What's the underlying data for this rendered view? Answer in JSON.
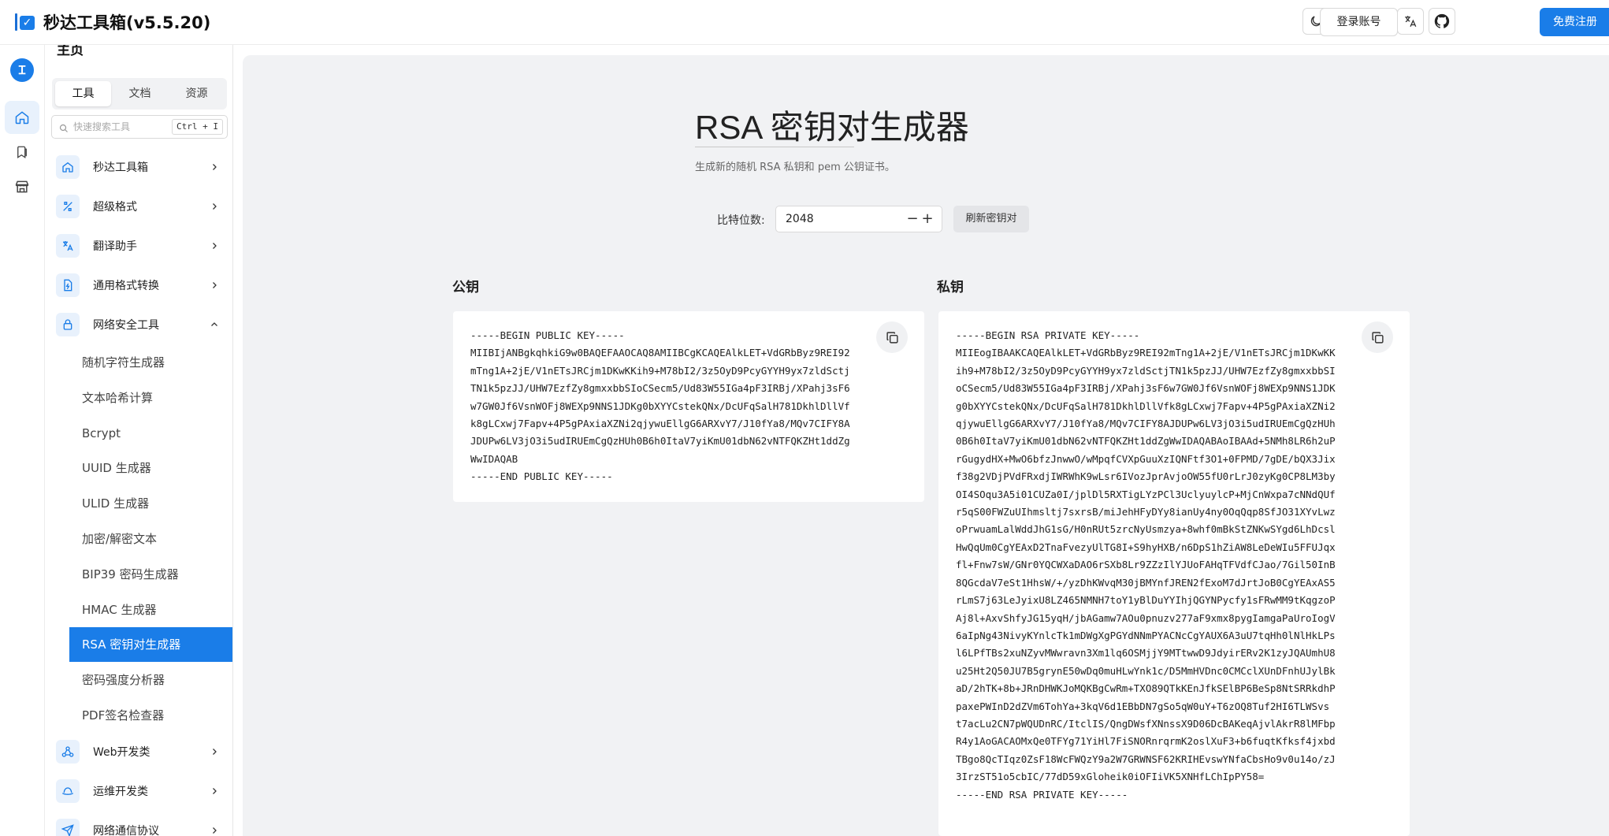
{
  "app": {
    "title": "秒达工具箱(v5.5.20)",
    "logo_check": "✓"
  },
  "header": {
    "icons": [
      "moon-icon",
      "font-icon",
      "search-text-icon",
      "translate-icon",
      "github-icon"
    ],
    "login_label": "登录账号",
    "register_label": "免费注册"
  },
  "rail": {
    "avatar_letter": "Ɪ",
    "items": [
      "home-icon",
      "bookmark-icon",
      "store-icon"
    ]
  },
  "sidebar": {
    "heading": "主页",
    "tabs": [
      "工具",
      "文档",
      "资源"
    ],
    "search_placeholder": "快速搜索工具",
    "search_shortcut": "Ctrl + I",
    "groups": [
      {
        "label": "秒达工具箱"
      },
      {
        "label": "超级格式"
      },
      {
        "label": "翻译助手"
      },
      {
        "label": "通用格式转换"
      },
      {
        "label": "网络安全工具"
      }
    ],
    "security_items": [
      "随机字符生成器",
      "文本哈希计算",
      "Bcrypt",
      "UUID 生成器",
      "ULID 生成器",
      "加密/解密文本",
      "BIP39 密码生成器",
      "HMAC 生成器",
      "RSA 密钥对生成器",
      "密码强度分析器",
      "PDF签名检查器"
    ],
    "more_groups": [
      {
        "label": "Web开发类"
      },
      {
        "label": "运维开发类"
      },
      {
        "label": "网络通信协议"
      }
    ]
  },
  "main": {
    "title": "RSA 密钥对生成器",
    "description": "生成新的随机 RSA 私钥和 pem 公钥证书。",
    "bits_label": "比特位数:",
    "bits_value": "2048",
    "minus": "−",
    "plus": "+",
    "refresh_label": "刷新密钥对",
    "public_label": "公钥",
    "private_label": "私钥",
    "public_key": "-----BEGIN PUBLIC KEY-----\nMIIBIjANBgkqhkiG9w0BAQEFAAOCAQ8AMIIBCgKCAQEAlkLET+VdGRbByz9REI92\nmTng1A+2jE/V1nETsJRCjm1DKwKKih9+M78bI2/3z5OyD9PcyGYYH9yx7zldSctj\nTN1k5pzJJ/UHW7EzfZy8gmxxbbSIoCSecm5/Ud83W55IGa4pF3IRBj/XPahj3sF6\nw7GW0Jf6VsnWOFj8WEXp9NNS1JDKg0bXYYCstekQNx/DcUFqSalH781DkhlDllVf\nk8gLCxwj7Fapv+4P5gPAxiaXZNi2qjywuEllgG6ARXvY7/J10fYa8/MQv7CIFY8A\nJDUPw6LV3jO3i5udIRUEmCgQzHUh0B6h0ItaV7yiKmU01dbN62vNTFQKZHt1ddZg\nWwIDAQAB\n-----END PUBLIC KEY-----",
    "private_key": "-----BEGIN RSA PRIVATE KEY-----\nMIIEogIBAAKCAQEAlkLET+VdGRbByz9REI92mTng1A+2jE/V1nETsJRCjm1DKwKK\nih9+M78bI2/3z5OyD9PcyGYYH9yx7zldSctjTN1k5pzJJ/UHW7EzfZy8gmxxbbSI\noCSecm5/Ud83W55IGa4pF3IRBj/XPahj3sF6w7GW0Jf6VsnWOFj8WEXp9NNS1JDK\ng0bXYYCstekQNx/DcUFqSalH781DkhlDllVfk8gLCxwj7Fapv+4P5gPAxiaXZNi2\nqjywuEllgG6ARXvY7/J10fYa8/MQv7CIFY8AJDUPw6LV3jO3i5udIRUEmCgQzHUh\n0B6h0ItaV7yiKmU01dbN62vNTFQKZHt1ddZgWwIDAQABAoIBAAd+5NMh8LR6h2uP\nrGugydHX+MwO6bfzJnwwO/wMpqfCVXpGuuXzIQNFtf3O1+0FPMD/7gDE/bQX3Jix\nf38g2VDjPVdFRxdjIWRWhK9wLsr6IVozJprAvjoOW55fU0rLrJ0zyKg0CP8LM3by\nOI4SOqu3A5i01CUZa0I/jplDl5RXTigLYzPCl3UclyuylcP+MjCnWxpa7cNNdQUf\nr5qS00FWZuUIhmsltj7sxrsB/miJehHFyDYy8ianUy4ny0OqQqp8SfJO31XYvLwz\noPrwuamLalWddJhG1sG/H0nRUt5zrcNyUsmzya+8whf0mBkStZNKwSYgd6LhDcsl\nHwQqUm0CgYEAxD2TnaFvezyUlTG8I+S9hyHXB/n6DpS1hZiAW8LeDeWIu5FFUJqx\nfl+Fnw7sW/GNr0YQCWXaDAO6rSXb8Lr9ZZzIlYJUoFAHqTFVdfCJao/7Gil50InB\n8QGcdaV7eSt1HhsW/+/yzDhKWvqM30jBMYnfJREN2fExoM7dJrtJoB0CgYEAxAS5\nrLmS7j63LeJyixU8LZ465NMNH7toY1yBlDuYYIhjQGYNPycfy1sFRwMM9tKqgzoP\nAj8l+AxvShfyJG15yqH/jbAGamw7AOu0pnuzv277aF9xmx8pygIamgaPaUroIogV\n6aIpNg43NivyKYnlcTk1mDWgXgPGYdNNmPYACNcCgYAUX6A3uU7tqHh0lNlHkLPs\nl6LPfTBs2xuNZyvMWwravn3Xm1lq6OSMjjY9MTtwwD9JdyirERv2K1zyJQAUmhU8\nu25Ht2Q50JU7B5grynE50wDq0muHLwYnk1c/D5MmHVDnc0CMCclXUnDFnhUJylBk\naD/2hTK+8b+JRnDHWKJoMQKBgCwRm+TXO89QTkKEnJfkSElBP6BeSp8NtSRRkdhP\npaxePWInD2dZVm6TohYa+3kqV6d1EBbDN7gSo5qW0uY+T6zOQ8Tuf2HI6TLWSvs\nt7acLu2CN7pWQUDnRC/ItclIS/QngDWsfXNnssX9D06DcBAKeqAjvlAkrR8lMFbp\nR4y1AoGACAOMxQe0TFYg71YiHl7FiSNORnrqrmK2oslXuF3+b6fuqtKfksf4jxbd\nTBgo8QcTIqz0ZsF18WcFWQzY9a2W7GRWNSF62KRIHEvswYNfaCbsHo9v0u14o/zJ\n3IrzST51o5cbIC/77dD59xGloheik0iOFIiVK5XNHfLChIpPY58=\n-----END RSA PRIVATE KEY-----"
  }
}
